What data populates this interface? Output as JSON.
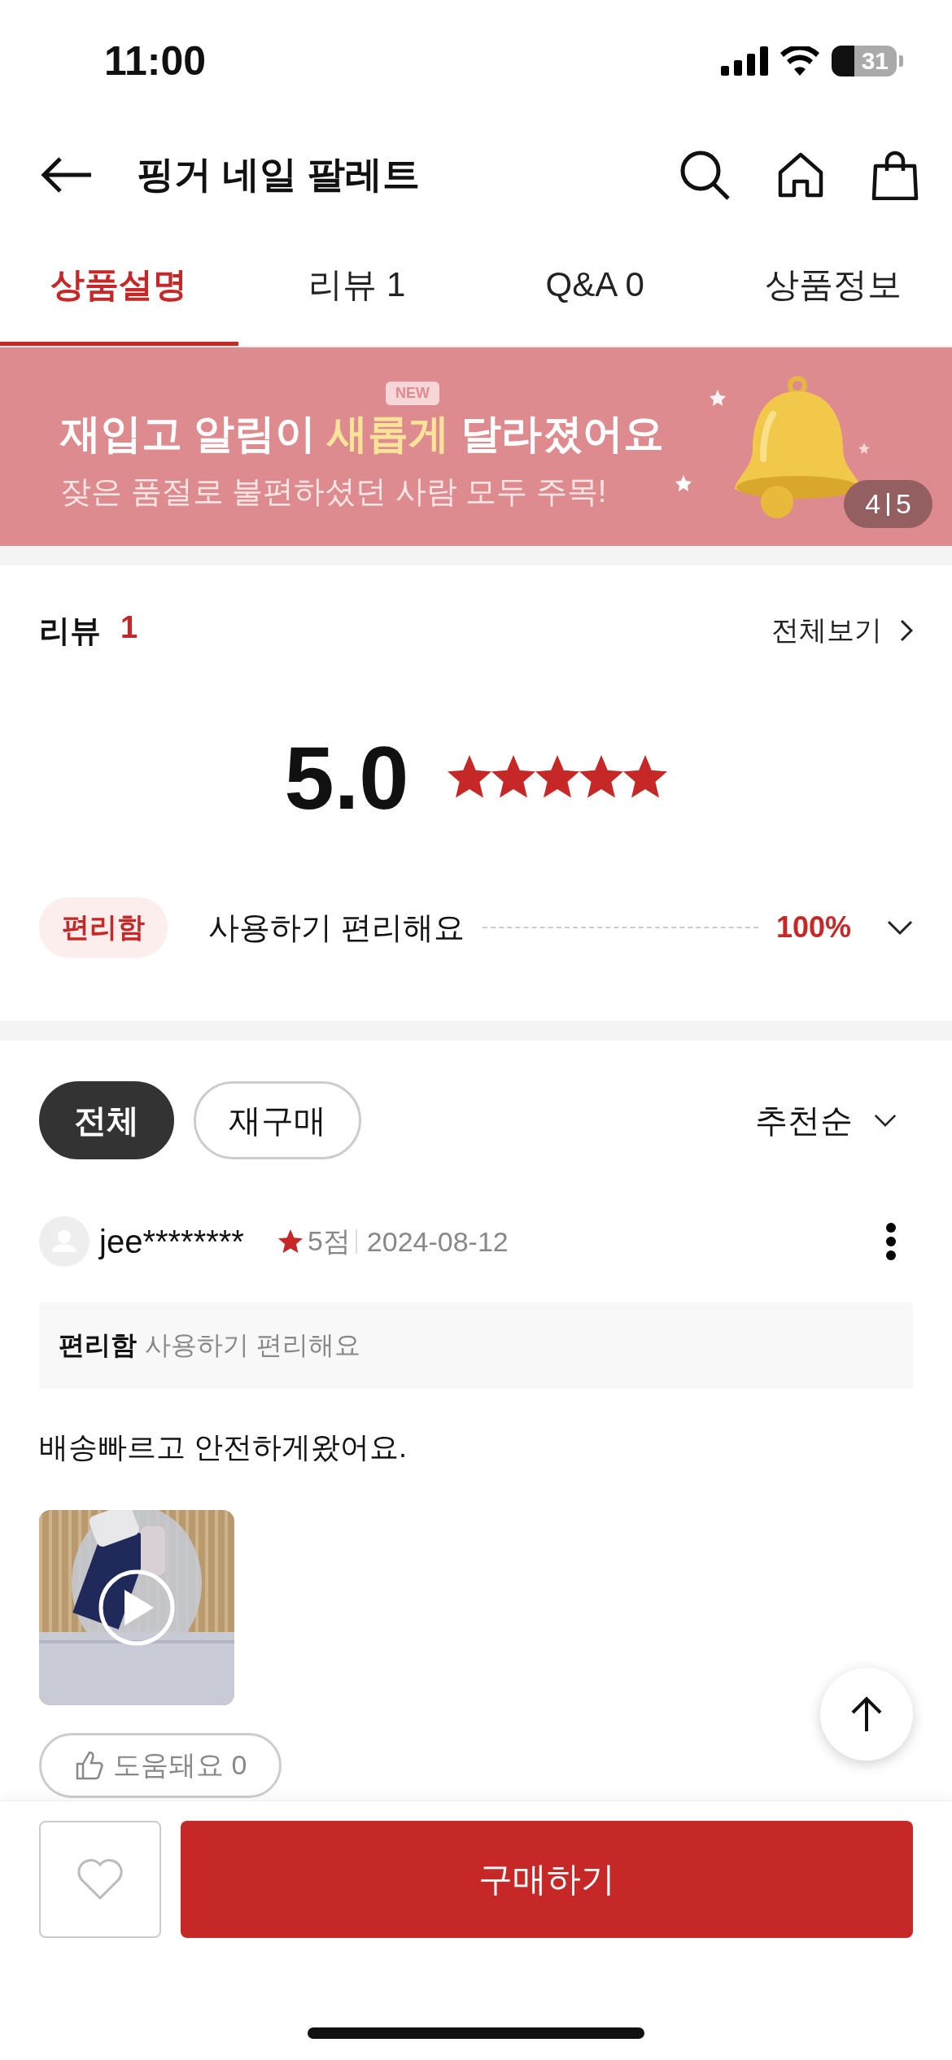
{
  "status_bar": {
    "time": "11:00",
    "battery": "31"
  },
  "header": {
    "title": "핑거 네일 팔레트"
  },
  "tabs": [
    {
      "label": "상품설명",
      "selected": true
    },
    {
      "label": "리뷰 1",
      "selected": false
    },
    {
      "label": "Q&A 0",
      "selected": false
    },
    {
      "label": "상품정보",
      "selected": false
    }
  ],
  "banner": {
    "badge": "NEW",
    "headline": "재입고 알림이 **새롭게** 달라졌어요",
    "subtitle": "잦은 품절로 불편하셨던 사람 모두 주목!",
    "counter_current": "4",
    "counter_total": "5"
  },
  "review_summary": {
    "title": "리뷰",
    "count": "1",
    "view_all": "전체보기",
    "score": "5.0",
    "stars": 5,
    "keywords": [
      {
        "tag": "편리함",
        "text": "사용하기 편리해요",
        "percent": "100%"
      }
    ]
  },
  "filters": [
    {
      "label": "전체",
      "selected": true
    },
    {
      "label": "재구매",
      "selected": false
    }
  ],
  "sort": "추천순",
  "reviews": [
    {
      "user": "jee********",
      "rating": "5점",
      "date": "2024-08-12",
      "tag": "편리함",
      "tag_text": "사용하기 편리해요",
      "body": "배송빠르고 안전하게왔어요.",
      "media": {
        "kind": "video"
      },
      "helpful": "도움돼요 0"
    }
  ],
  "bottom_bar": {
    "wishlisted": false,
    "buy": "구매하기"
  }
}
